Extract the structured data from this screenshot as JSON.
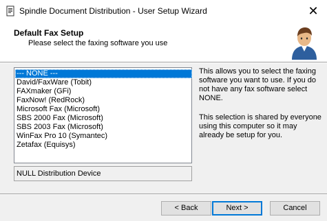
{
  "window": {
    "title": "Spindle Document Distribution - User Setup Wizard",
    "close_glyph": "✕"
  },
  "header": {
    "title": "Default Fax Setup",
    "subtitle": "Please select the faxing software you use"
  },
  "fax_list": {
    "items": [
      "--- NONE ---",
      "David/FaxWare (Tobit)",
      "FAXmaker (GFi)",
      "FaxNow! (RedRock)",
      "Microsoft Fax (Microsoft)",
      "SBS 2000 Fax (Microsoft)",
      "SBS 2003 Fax (Microsoft)",
      "WinFax Pro 10 (Symantec)",
      "Zetafax (Equisys)"
    ],
    "selected": "--- NONE ---"
  },
  "device_description": "NULL Distribution Device",
  "help": {
    "para1": "This allows you to select the faxing software you want to use. If you do not have any fax software select NONE.",
    "para2": "This selection is shared by everyone using this computer so it may already be setup for you."
  },
  "buttons": {
    "back": "< Back",
    "next": "Next >",
    "cancel": "Cancel"
  },
  "colors": {
    "selection": "#0078d7",
    "default_button_border": "#0078d7"
  },
  "icons": {
    "app": "document-icon",
    "header": "user-icon"
  }
}
